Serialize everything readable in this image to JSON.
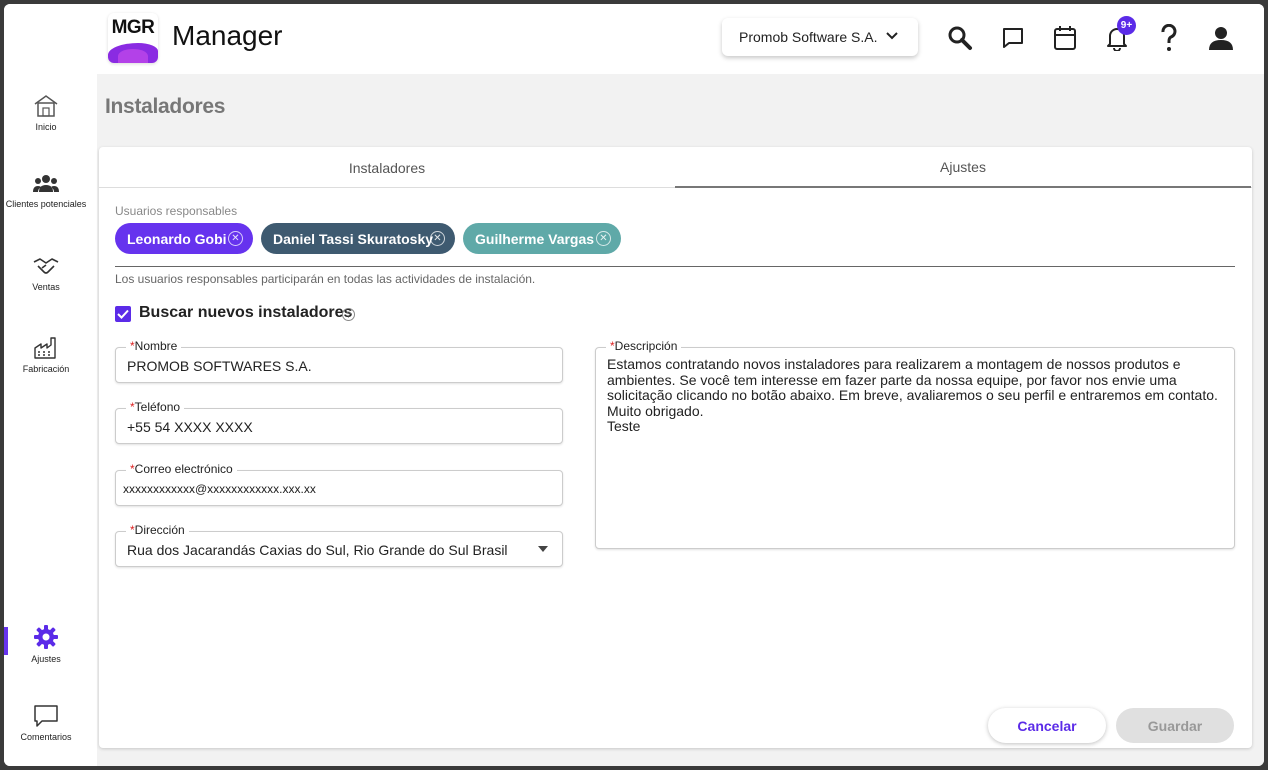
{
  "app": {
    "logo_text": "MGR",
    "name": "Manager"
  },
  "header": {
    "company": "Promob Software S.A.",
    "notification_badge": "9+"
  },
  "sidebar": {
    "items": [
      {
        "label": "Inicio",
        "icon": "home-icon"
      },
      {
        "label": "Clientes potenciales",
        "icon": "users-icon"
      },
      {
        "label": "Ventas",
        "icon": "handshake-icon"
      },
      {
        "label": "Fabricación",
        "icon": "factory-icon"
      },
      {
        "label": "Ajustes",
        "icon": "gear-icon",
        "active": true
      },
      {
        "label": "Comentarios",
        "icon": "comment-icon"
      }
    ]
  },
  "page": {
    "title": "Instaladores"
  },
  "tabs": [
    {
      "label": "Instaladores",
      "active": false
    },
    {
      "label": "Ajustes",
      "active": true
    }
  ],
  "responsibles": {
    "label": "Usuarios responsables",
    "chips": [
      {
        "name": "Leonardo Gobi",
        "color": "#6633ee"
      },
      {
        "name": "Daniel Tassi Skuratosky",
        "color": "#3e5a70"
      },
      {
        "name": "Guilherme Vargas",
        "color": "#5fa9a8"
      }
    ],
    "hint": "Los usuarios responsables participarán en todas las actividades de instalación."
  },
  "search_installers": {
    "label": "Buscar nuevos instaladores",
    "checked": true
  },
  "form": {
    "name": {
      "label": "Nombre",
      "value": "PROMOB SOFTWARES S.A."
    },
    "phone": {
      "label": "Teléfono",
      "value": "+55 54  XXXX XXXX"
    },
    "email": {
      "label": "Correo electrónico",
      "value": "xxxxxxxxxxxx@xxxxxxxxxxxx.xxx.xx"
    },
    "address": {
      "label": "Dirección",
      "value": "Rua dos Jacarandás Caxias do Sul, Rio Grande do Sul Brasil"
    },
    "description": {
      "label": "Descripción",
      "value": "Estamos contratando novos instaladores para realizarem a montagem de nossos produtos e ambientes. Se você tem interesse em fazer parte da nossa equipe, por favor nos envie uma solicitação clicando no botão abaixo. Em breve, avaliaremos o seu perfil e entraremos em contato. Muito obrigado.\nTeste"
    }
  },
  "actions": {
    "cancel": "Cancelar",
    "save": "Guardar"
  }
}
